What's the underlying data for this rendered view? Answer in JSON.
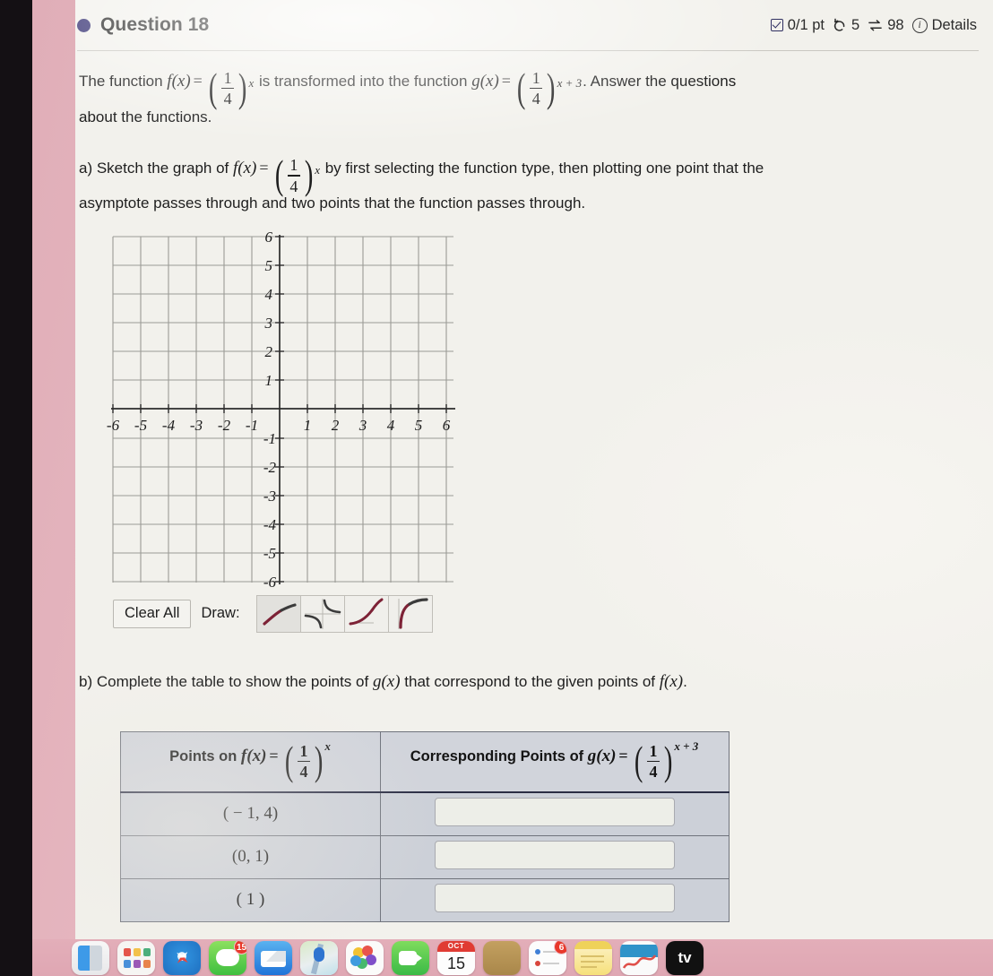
{
  "header": {
    "question_label": "Question 18",
    "score": "0/1 pt",
    "attempts": "5",
    "views": "98",
    "details_label": "Details",
    "icons": {
      "bullet": "filled-circle",
      "score": "checkbox-icon",
      "attempts": "undo-icon",
      "views": "swap-icon",
      "info": "info-icon"
    }
  },
  "intro": {
    "text_a": "The function",
    "fx_label": "f(x)",
    "equals": "=",
    "base_num": "1",
    "base_den": "4",
    "f_exponent": "x",
    "text_b": "is transformed into the function",
    "gx_label": "g(x)",
    "g_exponent": "x + 3",
    "text_c": ". Answer the questions",
    "text_d": "about the functions."
  },
  "part_a": {
    "prefix": "a) Sketch the graph of",
    "fx_label": "f(x)",
    "equals": "=",
    "base_num": "1",
    "base_den": "4",
    "exponent": "x",
    "suffix": "by first selecting the function type, then plotting one point that the",
    "line2": "asymptote passes through and two points that the function passes through."
  },
  "graph": {
    "x_ticks": [
      "-6",
      "-5",
      "-4",
      "-3",
      "-2",
      "-1",
      "1",
      "2",
      "3",
      "4",
      "5",
      "6"
    ],
    "y_ticks": [
      "6",
      "5",
      "4",
      "3",
      "2",
      "1",
      "-1",
      "-2",
      "-3",
      "-4",
      "-5",
      "-6"
    ],
    "xlim": [
      -6,
      6
    ],
    "ylim": [
      -6,
      6
    ],
    "grid": true
  },
  "toolbar": {
    "clear_all_label": "Clear All",
    "draw_label": "Draw:",
    "tools": [
      {
        "name": "logarithmic-curve-tool",
        "selected": true
      },
      {
        "name": "rational-curve-tool",
        "selected": false
      },
      {
        "name": "exponential-curve-tool",
        "selected": false
      },
      {
        "name": "root-curve-tool",
        "selected": false
      }
    ]
  },
  "part_b": {
    "text": "b) Complete the table to show the points of",
    "gx_label": "g(x)",
    "text_mid": "that correspond to the given points of",
    "fx_label": "f(x)",
    "period": "."
  },
  "table": {
    "header_left_prefix": "Points on",
    "header_left_fn": "f(x)",
    "header_right_prefix": "Corresponding Points of",
    "header_right_fn": "g(x)",
    "equals": "=",
    "base_num": "1",
    "base_den": "4",
    "f_exponent": "x",
    "g_exponent": "x + 3",
    "rows": [
      {
        "point": "( − 1, 4)",
        "answer": ""
      },
      {
        "point": "(0, 1)",
        "answer": ""
      },
      {
        "point": "( 1 )",
        "answer": ""
      }
    ]
  },
  "dock": {
    "calendar_month": "OCT",
    "calendar_day": "15",
    "mail_badge": "15",
    "notes_badge": "6",
    "tv_label": "tv"
  },
  "colors": {
    "page_bg": "#f2f1ec",
    "bezel": "#e3b0ba",
    "accent_navy": "#2e2a6e",
    "table_fill": "#ccd0d8",
    "table_header": "#d1d4db",
    "input_fill": "#edeee8",
    "badge_red": "#e8382b"
  }
}
